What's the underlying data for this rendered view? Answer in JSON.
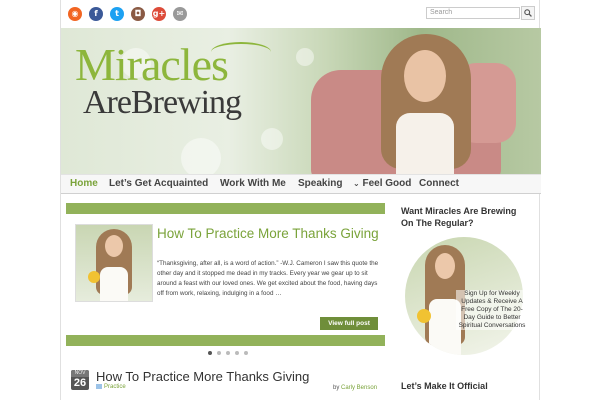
{
  "colors": {
    "accent": "#7aa33a",
    "bar": "#92b25a",
    "button": "#6f8e3a"
  },
  "social": [
    {
      "name": "rss-icon",
      "glyph": "◉",
      "color": "#f26522"
    },
    {
      "name": "facebook-icon",
      "glyph": "f",
      "color": "#3b5998"
    },
    {
      "name": "twitter-icon",
      "glyph": "t",
      "color": "#1da1f2"
    },
    {
      "name": "instagram-icon",
      "glyph": "◘",
      "color": "#8a5a44"
    },
    {
      "name": "googleplus-icon",
      "glyph": "g+",
      "color": "#dd4b39"
    },
    {
      "name": "email-icon",
      "glyph": "✉",
      "color": "#999999"
    }
  ],
  "search": {
    "placeholder": "Search",
    "button_icon": "search-icon"
  },
  "logo": {
    "line1": "Miracles",
    "line2": "AreBrewing"
  },
  "nav": {
    "home": "Home",
    "acquainted": "Let’s Get Acquainted",
    "work": "Work With Me",
    "speaking": "Speaking",
    "feelgood": "Feel Good",
    "connect": "Connect"
  },
  "slider": {
    "title": "How To Practice More Thanks Giving",
    "excerpt": "“Thanksgiving, after all, is a word of action.”  -W.J. Cameron I saw this quote the other day and it stopped me dead in my tracks. Every year we gear up to sit around a feast with our loved ones. We get excited about the food, having days off from work, relaxing, indulging in a food …",
    "button": "View full post",
    "dots": 5,
    "active_dot": 0
  },
  "post": {
    "month": "NOV",
    "day": "26",
    "title": "How To Practice More Thanks Giving",
    "category": "Practice",
    "by": "by",
    "author": "Carly Benson"
  },
  "sidebar": {
    "heading1": "Want Miracles Are Brewing On The Regular?",
    "optin_text": "Sign Up for Weekly Updates & Receive A Free Copy of The 20-Day Guide to Better Spiritual Conversations",
    "heading2": "Let’s Make It Official"
  }
}
